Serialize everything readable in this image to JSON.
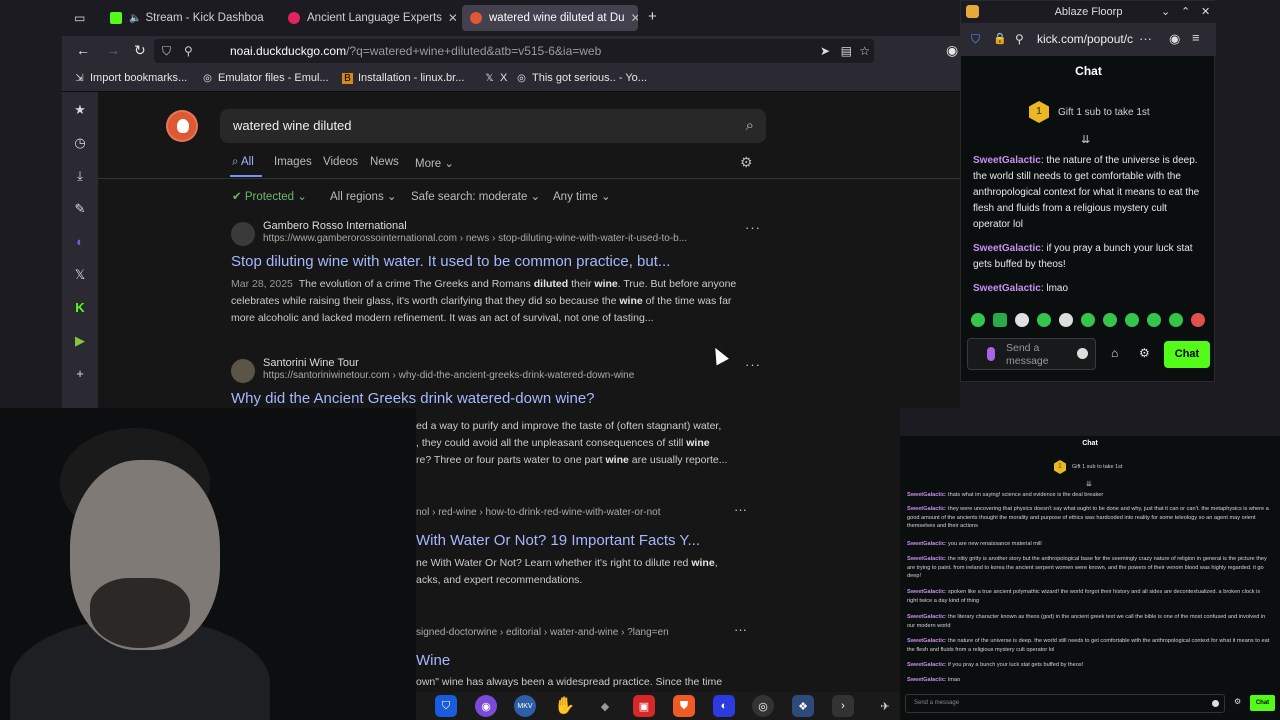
{
  "browser": {
    "tabs": [
      {
        "label": "Stream - Kick Dashboa",
        "muted": true
      },
      {
        "label": "Ancient Language Experts"
      },
      {
        "label": "watered wine diluted at Du"
      }
    ],
    "url_host": "noai.duckduckgo.com",
    "url_path": "/?q=watered+wine+diluted&atb=v515-6&ia=web",
    "bookmarks": [
      "Import bookmarks...",
      "Emulator files - Emul...",
      "Installation - linux.br...",
      "X",
      "This got serious.. - Yo..."
    ]
  },
  "search": {
    "query": "watered wine diluted",
    "tabs": [
      "All",
      "Images",
      "Videos",
      "News",
      "More"
    ],
    "filters": [
      "Protected",
      "All regions",
      "Safe search: moderate",
      "Any time"
    ]
  },
  "results": [
    {
      "site": "Gambero Rosso International",
      "url": "https://www.gamberorossointernational.com › news › stop-diluting-wine-with-water-it-used-to-b...",
      "title": "Stop diluting wine with water. It used to be common practice, but...",
      "date": "Mar 28, 2025",
      "snippet_a": "The evolution of a crime The Greeks and Romans ",
      "b1": "diluted",
      "snippet_b": " their ",
      "b2": "wine",
      "snippet_c": ". True. But before anyone celebrates while raising their glass, it's worth clarifying that they did so because the ",
      "b3": "wine",
      "snippet_d": " of the time was far more alcoholic and lacked modern refinement. It was an act of survival, not one of tasting..."
    },
    {
      "site": "Santorini Wine Tour",
      "url": "https://santoriniwinetour.com › why-did-the-ancient-greeks-drink-watered-down-wine",
      "title": "Why did the Ancient Greeks drink watered-down wine?",
      "line1": "ed a way to purify and improve the taste of (often stagnant) water,",
      "line2a": ", they could avoid all the unpleasant consequences of still ",
      "line2b": "wine",
      "line3a": "re? Three or four parts water to one part ",
      "line3b": "wine",
      "line3c": " are usually reporte..."
    },
    {
      "url_tail": "nol › red-wine › how-to-drink-red-wine-with-water-or-not",
      "title_tail": "With Water Or Not? 19 Important Facts Y...",
      "line1a": "ne With Water Or Not? Learn whether it's right to dilute red ",
      "line1b": "wine",
      "line2": "acks, and expert recommendations."
    },
    {
      "url_tail": "signed-doctorwine › editorial › water-and-wine › ?lang=en",
      "title_tail": "Wine",
      "line1": "own\" wine has always been a widespread practice. Since the time"
    }
  ],
  "kick": {
    "window_title": "Ablaze Floorp",
    "url": "kick.com/popout/c",
    "chat_label": "Chat",
    "gift_text": "Gift 1 sub to take 1st",
    "gift_count": "1",
    "messages": [
      {
        "name": "SweetGalactic",
        "text": " the nature of the universe is deep. the world still needs to get comfortable with the anthropological context for what it means to eat the flesh and fluids from a religious mystery cult operator lol"
      },
      {
        "name": "SweetGalactic",
        "text": " if you pray a bunch your luck stat gets buffed by theos!"
      },
      {
        "name": "SweetGalactic",
        "text": " lmao"
      }
    ],
    "input_placeholder": "Send a message",
    "send_label": "Chat",
    "accent": "#53fc18"
  },
  "chat2": {
    "chat_label": "Chat",
    "gift_text": "Gift 1 sub to take 1st",
    "gift_count": "1",
    "messages": [
      {
        "name": "SweetGalactic",
        "text": " thats what im saying! science and evidence is the deal breaker"
      },
      {
        "name": "SweetGalactic",
        "text": " they were uncovering that physics doesn't say what ought to be done and why, just that it can or can't. the metaphysics is where a good amount of the ancients thought the morality and purpose of ethics was hardcoded into reality for some teleology so an agent may orient themselves and their actions"
      },
      {
        "name": "SweetGalactic",
        "text": " you are new renaissance material mill"
      },
      {
        "name": "SweetGalactic",
        "text": " the nitty gritty is another story but the anthropological base for the seemingly crazy nature of religion in general is the picture they are trying to paint. from ireland to korea the ancient serpent women were known, and the powers of their venom blood was highly regarded. it go deep!"
      },
      {
        "name": "SweetGalactic",
        "text": " spoken like a true ancient polymathic wizard! the world forgot their history and all sides are decontextualized. a broken clock is right twice a day kind of thing"
      },
      {
        "name": "SweetGalactic",
        "text": " the literary character known as theos (god) in the ancient greek text we call the bible is one of the most confused and involved in our modern world"
      },
      {
        "name": "SweetGalactic",
        "text": " the nature of the universe is deep. the world still needs to get comfortable with the anthropological context for what it means to eat the flesh and fluids from a religious mystery cult operator lol"
      },
      {
        "name": "SweetGalactic",
        "text": " if you pray a bunch your luck stat gets buffed by theos!"
      },
      {
        "name": "SweetGalactic",
        "text": " lmao"
      }
    ],
    "input_placeholder": "Send a message",
    "send_label": "Chat"
  },
  "taskbar": {
    "apps": [
      "bitwarden-icon",
      "firefox-icon",
      "mkv-icon",
      "hand-icon",
      "game-icon",
      "redapp-icon",
      "brave-icon",
      "floorp-icon",
      "obs-icon",
      "terminal-app-icon",
      "arrow-icon",
      "discord-icon"
    ]
  }
}
